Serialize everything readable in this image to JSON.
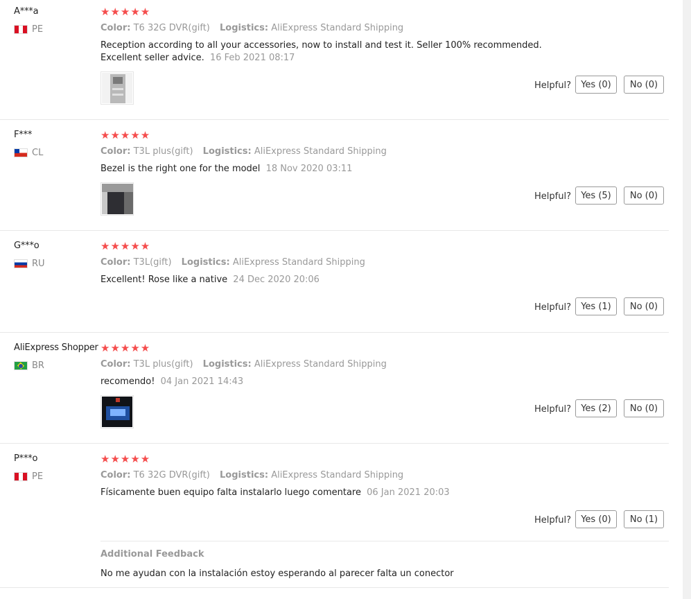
{
  "reviews": [
    {
      "user": "A***a",
      "country_code": "PE",
      "stars": "★★★★★",
      "color_label": "Color:",
      "color_value": "T6 32G DVR(gift)",
      "logistics_label": "Logistics:",
      "logistics_value": "AliExpress Standard Shipping",
      "text": "Reception according to all your accessories, now to install and test it. Seller 100% recommended. Excellent seller advice.",
      "date": "16 Feb 2021 08:17",
      "helpful_label": "Helpful?",
      "yes_label": "Yes (0)",
      "no_label": "No (0)"
    },
    {
      "user": "F***",
      "country_code": "CL",
      "stars": "★★★★★",
      "color_label": "Color:",
      "color_value": "T3L plus(gift)",
      "logistics_label": "Logistics:",
      "logistics_value": "AliExpress Standard Shipping",
      "text": "Bezel is the right one for the model",
      "date": "18 Nov 2020 03:11",
      "helpful_label": "Helpful?",
      "yes_label": "Yes (5)",
      "no_label": "No (0)"
    },
    {
      "user": "G***o",
      "country_code": "RU",
      "stars": "★★★★★",
      "color_label": "Color:",
      "color_value": "T3L(gift)",
      "logistics_label": "Logistics:",
      "logistics_value": "AliExpress Standard Shipping",
      "text": "Excellent! Rose like a native",
      "date": "24 Dec 2020 20:06",
      "helpful_label": "Helpful?",
      "yes_label": "Yes (1)",
      "no_label": "No (0)"
    },
    {
      "user": "AliExpress Shopper",
      "country_code": "BR",
      "stars": "★★★★★",
      "color_label": "Color:",
      "color_value": "T3L plus(gift)",
      "logistics_label": "Logistics:",
      "logistics_value": "AliExpress Standard Shipping",
      "text": "recomendo!",
      "date": "04 Jan 2021 14:43",
      "helpful_label": "Helpful?",
      "yes_label": "Yes (2)",
      "no_label": "No (0)"
    },
    {
      "user": "P***o",
      "country_code": "PE",
      "stars": "★★★★★",
      "color_label": "Color:",
      "color_value": "T6 32G DVR(gift)",
      "logistics_label": "Logistics:",
      "logistics_value": "AliExpress Standard Shipping",
      "text": "Físicamente buen equipo falta instalarlo luego comentare",
      "date": "06 Jan 2021 20:03",
      "helpful_label": "Helpful?",
      "yes_label": "Yes (0)",
      "no_label": "No (1)",
      "additional_title": "Additional Feedback",
      "additional_text": "No me ayudan con la instalación estoy esperando al parecer falta un conector"
    }
  ],
  "colors": {
    "star": "#f54d4d",
    "muted_text": "#999999",
    "divider": "#e8e8e8"
  }
}
